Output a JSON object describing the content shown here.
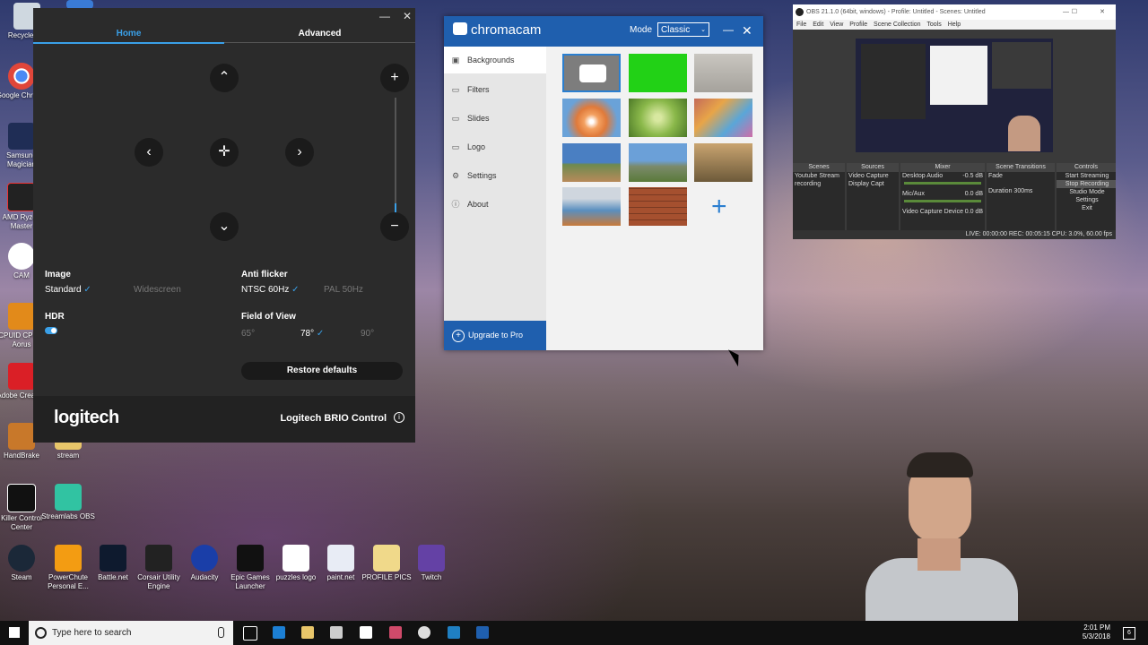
{
  "desktop": {
    "icons": [
      {
        "label": "Recycle Bin",
        "name": "recycle-bin-icon"
      },
      {
        "label": "Google Chrome",
        "name": "chrome-icon"
      },
      {
        "label": "Samsung Magician",
        "name": "samsung-magician-icon"
      },
      {
        "label": "AMD Ryzen Master",
        "name": "amd-ryzen-master-icon"
      },
      {
        "label": "CAM",
        "name": "cam-icon"
      },
      {
        "label": "CPUID CPU-Z Aorus",
        "name": "cpuz-icon"
      },
      {
        "label": "Adobe Creative",
        "name": "adobe-creative-icon"
      },
      {
        "label": "HandBrake",
        "name": "handbrake-icon"
      },
      {
        "label": "stream",
        "name": "folder-icon"
      },
      {
        "label": "Killer Control Center",
        "name": "killer-control-center-icon"
      },
      {
        "label": "Streamlabs OBS",
        "name": "streamlabs-obs-icon"
      },
      {
        "label": "Steam",
        "name": "steam-icon"
      },
      {
        "label": "PowerChute Personal E...",
        "name": "powerchute-icon"
      },
      {
        "label": "Battle.net",
        "name": "battlenet-icon"
      },
      {
        "label": "Corsair Utility Engine",
        "name": "corsair-icon"
      },
      {
        "label": "Audacity",
        "name": "audacity-icon"
      },
      {
        "label": "Epic Games Launcher",
        "name": "epic-games-icon"
      },
      {
        "label": "puzzles logo",
        "name": "puzzles-logo-icon"
      },
      {
        "label": "paint.net",
        "name": "paintnet-icon"
      },
      {
        "label": "PROFILE PICS",
        "name": "profile-pics-icon"
      },
      {
        "label": "Twitch",
        "name": "twitch-icon"
      }
    ]
  },
  "logitech": {
    "tabs": {
      "home": "Home",
      "advanced": "Advanced"
    },
    "controls": {
      "up": "⌃",
      "down": "⌄",
      "left": "‹",
      "right": "›",
      "center": "✛",
      "zoom_in": "+",
      "zoom_out": "−"
    },
    "zoom_level": 0.1,
    "image": {
      "label": "Image",
      "standard": "Standard",
      "widescreen": "Widescreen"
    },
    "hdr": {
      "label": "HDR",
      "enabled": true
    },
    "anti_flicker": {
      "label": "Anti flicker",
      "ntsc": "NTSC 60Hz",
      "pal": "PAL 50Hz"
    },
    "fov": {
      "label": "Field of View",
      "opt1": "65°",
      "opt2": "78°",
      "opt3": "90°"
    },
    "restore": "Restore defaults",
    "brand": "logitech",
    "product": "Logitech BRIO Control",
    "window_min": "—",
    "window_close": "✕",
    "check": "✓",
    "info": "i"
  },
  "chromacam": {
    "title": "chromacam",
    "mode_label": "Mode",
    "mode_value": "Classic",
    "min": "—",
    "close": "✕",
    "nav": [
      {
        "label": "Backgrounds",
        "icon": "▣"
      },
      {
        "label": "Filters",
        "icon": "▭"
      },
      {
        "label": "Slides",
        "icon": "▭"
      },
      {
        "label": "Logo",
        "icon": "▭"
      },
      {
        "label": "Settings",
        "icon": "⚙"
      },
      {
        "label": "About",
        "icon": "ⓘ"
      }
    ],
    "upgrade": "Upgrade to Pro",
    "upgrade_icon": "+",
    "add": "+",
    "thumb_colors": [
      "#8a8a8a",
      "#22d116",
      "#b9b6b0",
      "#e6864a",
      "#8ab84a",
      "#c46b5a",
      "#4a7fc2",
      "#6ba0d8",
      "#c9a470",
      "#5a8fbf",
      "#a5502f"
    ]
  },
  "obs": {
    "title": "OBS 21.1.0 (64bit, windows) - Profile: Untitled - Scenes: Untitled",
    "menu": [
      "File",
      "Edit",
      "View",
      "Profile",
      "Scene Collection",
      "Tools",
      "Help"
    ],
    "panels": {
      "scenes": {
        "header": "Scenes",
        "items": [
          "Youtube Stream",
          "recording"
        ]
      },
      "sources": {
        "header": "Sources",
        "items": [
          "Video Capture",
          "Display Capt"
        ]
      },
      "mixer": {
        "header": "Mixer",
        "items": [
          {
            "name": "Desktop Audio",
            "value": "-0.5 dB"
          },
          {
            "name": "Mic/Aux",
            "value": "0.0 dB"
          },
          {
            "name": "Video Capture Device",
            "value": "0.0 dB"
          }
        ]
      },
      "transitions": {
        "header": "Scene Transitions",
        "type": "Fade",
        "duration_label": "Duration",
        "duration": "300ms"
      },
      "controls": {
        "header": "Controls",
        "buttons": [
          "Start Streaming",
          "Stop Recording",
          "Studio Mode",
          "Settings",
          "Exit"
        ]
      }
    },
    "status": "LIVE: 00:00:00    REC: 00:05:15    CPU: 3.0%, 60.00 fps"
  },
  "taskbar": {
    "search_placeholder": "Type here to search",
    "time": "2:01 PM",
    "date": "5/3/2018",
    "notif_count": "6"
  }
}
